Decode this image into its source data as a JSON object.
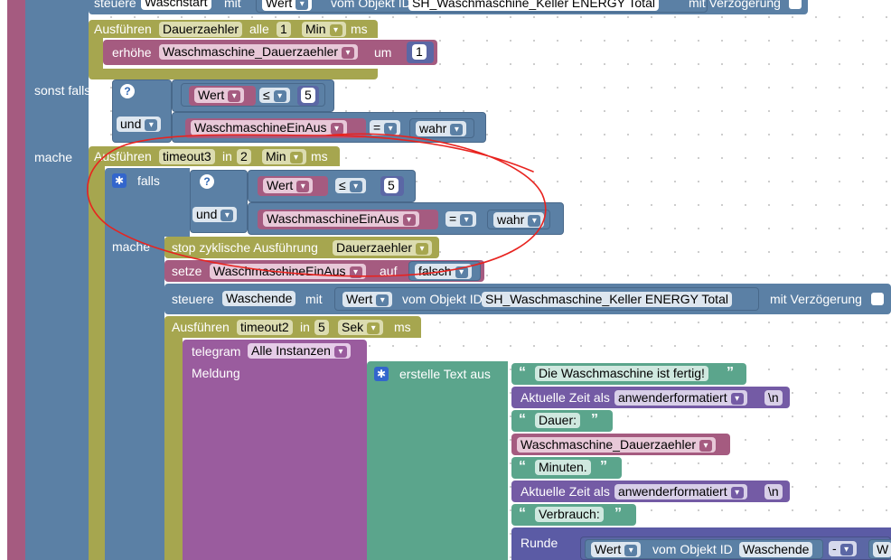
{
  "row_top": {
    "steuere": "steuere",
    "target": "Waschstart",
    "mit": "mit",
    "wert": "Wert",
    "vom_objekt": "vom Objekt ID",
    "object_id": "SH_Waschmaschine_Keller ENERGY  Total",
    "mit_verz": "mit Verzögerung"
  },
  "interval_block": {
    "ausfuehren": "Ausführen",
    "name": "Dauerzaehler",
    "alle": "alle",
    "value": "1",
    "unit": "Min",
    "ms": "ms"
  },
  "increment_block": {
    "erhoehe": "erhöhe",
    "variable": "Waschmaschine_Dauerzaehler",
    "um": "um",
    "value": "1"
  },
  "sonst_falls_label": "sonst falls",
  "help_icon": "?",
  "compare_1": {
    "wert": "Wert",
    "op": "≤",
    "value": "5"
  },
  "and_1": {
    "label": "und"
  },
  "compare_2": {
    "variable": "WaschmaschineEinAus",
    "op": "=",
    "value": "wahr"
  },
  "mache_label": "mache",
  "timeout3": {
    "ausfuehren": "Ausführen",
    "name": "timeout3",
    "in": "in",
    "value": "2",
    "unit": "Min",
    "ms": "ms"
  },
  "falls_label": "falls",
  "compare_3": {
    "wert": "Wert",
    "op": "≤",
    "value": "5"
  },
  "and_2": {
    "label": "und"
  },
  "compare_4": {
    "variable": "WaschmaschineEinAus",
    "op": "=",
    "value": "wahr"
  },
  "mache_label_2": "mache",
  "stop_block": {
    "text": "stop zyklische Ausführung",
    "target": "Dauerzaehler"
  },
  "set_block": {
    "setze": "setze",
    "variable": "WaschmaschineEinAus",
    "auf": "auf",
    "value": "falsch"
  },
  "control_block": {
    "steuere": "steuere",
    "target": "Waschende",
    "mit": "mit",
    "wert": "Wert",
    "vom_objekt": "vom Objekt ID",
    "object_id": "SH_Waschmaschine_Keller ENERGY  Total",
    "mit_verz": "mit Verzögerung"
  },
  "timeout2": {
    "ausfuehren": "Ausführen",
    "name": "timeout2",
    "in": "in",
    "value": "5",
    "unit": "Sek",
    "ms": "ms"
  },
  "telegram": {
    "label": "telegram",
    "target": "Alle Instanzen",
    "meldung": "Meldung"
  },
  "text_join": {
    "label": "erstelle Text aus",
    "open_quote": "“",
    "close_quote": "”",
    "t1": "Die Waschmaschine ist fertig!",
    "time1_label": "Aktuelle Zeit als",
    "time1_format": "anwenderformatiert",
    "newline": "\\n",
    "t2": "Dauer:",
    "var": "Waschmaschine_Dauerzaehler",
    "t3": "Minuten.",
    "time2_label": "Aktuelle Zeit als",
    "time2_format": "anwenderformatiert",
    "t4": "Verbrauch:",
    "runde": "Runde",
    "wert": "Wert",
    "vom_objekt": "vom Objekt ID",
    "object_id": "Waschende",
    "minus": "-",
    "w": "W"
  },
  "colors": {
    "annotation": "#e8231f",
    "logic": "#5b80a5",
    "timer": "#a6a64f",
    "variable": "#a55b80",
    "text": "#5ba58c",
    "time": "#745ba5",
    "telegram": "#9a5c9e"
  }
}
